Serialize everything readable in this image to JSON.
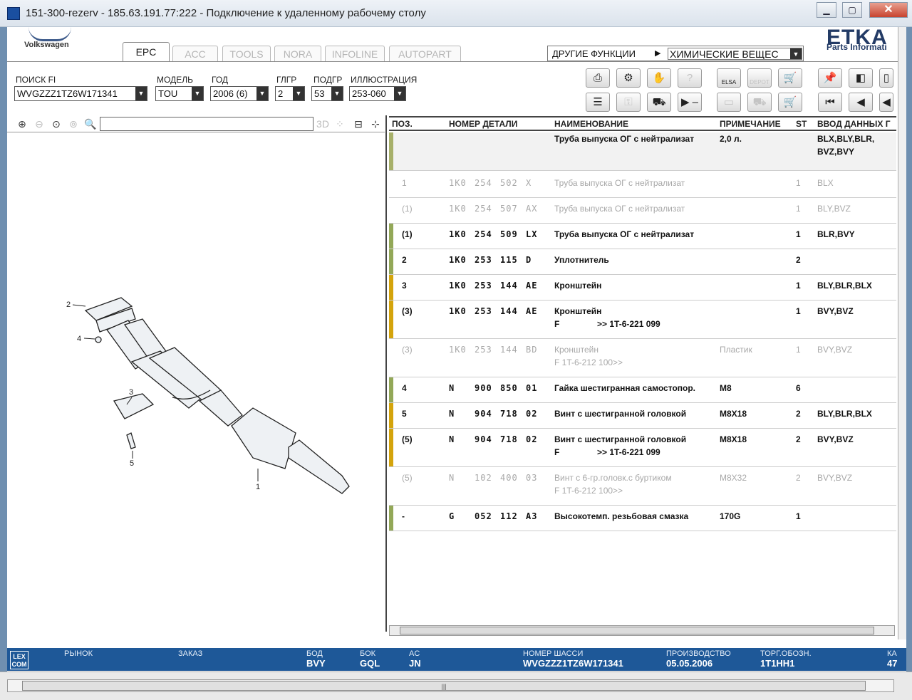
{
  "window": {
    "title": "151-300-rezerv - 185.63.191.77:222 - Подключение к удаленному рабочему столу"
  },
  "brand": {
    "vw": "Volkswagen",
    "etka": "ETKA",
    "etka_sub": "Parts Informati"
  },
  "tabs": [
    "EPC",
    "ACC",
    "TOOLS",
    "NORA",
    "INFOLINE",
    "AUTOPART"
  ],
  "other_functions": {
    "label": "ДРУГИЕ ФУНКЦИИ",
    "selected": "ХИМИЧЕСКИЕ ВЕЩЕС"
  },
  "filters": {
    "search_label": "ПОИСК FI",
    "search_value": "WVGZZZ1TZ6W171341",
    "model_label": "МОДЕЛЬ",
    "model_value": "TOU",
    "year_label": "ГОД",
    "year_value": "2006 (6)",
    "group_label": "ГЛГР",
    "group_value": "2",
    "subgroup_label": "ПОДГР",
    "subgroup_value": "53",
    "illustration_label": "ИЛЛЮСТРАЦИЯ",
    "illustration_value": "253-060"
  },
  "toolbar_icons": {
    "elsa": "ELSA",
    "depot": "DEPOT"
  },
  "illustration_labels": [
    "2",
    "4",
    "3",
    "5",
    "1"
  ],
  "grid": {
    "headers": {
      "pos": "ПОЗ.",
      "part": "НОМЕР ДЕТАЛИ",
      "name": "НАИМЕНОВАНИЕ",
      "note": "ПРИМЕЧАНИЕ",
      "st": "ST",
      "input": "ВВОД ДАННЫХ Г"
    },
    "header_row": {
      "name": "Труба выпуска ОГ с нейтрализат",
      "note": "2,0 л.",
      "input1": "BLX,BLY,BLR,",
      "input2": "BVZ,BVY"
    },
    "rows": [
      {
        "pos": "1",
        "p1": "1K0",
        "p2": "254",
        "p3": "502",
        "p4": "X",
        "name": "Труба выпуска ОГ с нейтрализат",
        "name2": "",
        "note": "",
        "st": "1",
        "input": "BLX"
      },
      {
        "pos": "(1)",
        "p1": "1K0",
        "p2": "254",
        "p3": "507",
        "p4": "AX",
        "name": "Труба выпуска ОГ с нейтрализат",
        "name2": "",
        "note": "",
        "st": "1",
        "input": "BLY,BVZ"
      },
      {
        "pos": "(1)",
        "p1": "1K0",
        "p2": "254",
        "p3": "509",
        "p4": "LX",
        "name": "Труба выпуска ОГ с нейтрализат",
        "name2": "",
        "note": "",
        "st": "1",
        "input": "BLR,BVY"
      },
      {
        "pos": "2",
        "p1": "1K0",
        "p2": "253",
        "p3": "115",
        "p4": "D",
        "name": "Уплотнитель",
        "name2": "",
        "note": "",
        "st": "2",
        "input": ""
      },
      {
        "pos": "3",
        "p1": "1K0",
        "p2": "253",
        "p3": "144",
        "p4": "AE",
        "name": "Кронштейн",
        "name2": "",
        "note": "",
        "st": "1",
        "input": "BLY,BLR,BLX"
      },
      {
        "pos": "(3)",
        "p1": "1K0",
        "p2": "253",
        "p3": "144",
        "p4": "AE",
        "name": "Кронштейн",
        "name2a": "F",
        "name2b": ">> 1T-6-221 099",
        "note": "",
        "st": "1",
        "input": "BVY,BVZ"
      },
      {
        "pos": "(3)",
        "p1": "1K0",
        "p2": "253",
        "p3": "144",
        "p4": "BD",
        "name": "Кронштейн",
        "name2": "F 1T-6-212 100>>",
        "note": "Пластик",
        "st": "1",
        "input": "BVY,BVZ"
      },
      {
        "pos": "4",
        "p1": "N",
        "p2": "900",
        "p3": "850",
        "p4": "01",
        "name": "Гайка шестигранная самостопор.",
        "name2": "",
        "note": "M8",
        "st": "6",
        "input": ""
      },
      {
        "pos": "5",
        "p1": "N",
        "p2": "904",
        "p3": "718",
        "p4": "02",
        "name": "Винт с шестигранной головкой",
        "name2": "",
        "note": "M8X18",
        "st": "2",
        "input": "BLY,BLR,BLX"
      },
      {
        "pos": "(5)",
        "p1": "N",
        "p2": "904",
        "p3": "718",
        "p4": "02",
        "name": "Винт с шестигранной головкой",
        "name2a": "F",
        "name2b": ">> 1T-6-221 099",
        "note": "M8X18",
        "st": "2",
        "input": "BVY,BVZ"
      },
      {
        "pos": "(5)",
        "p1": "N",
        "p2": "102",
        "p3": "400",
        "p4": "03",
        "name": "Винт с 6-гр.головк.с буртиком",
        "name2": "F 1T-6-212 100>>",
        "note": "M8X32",
        "st": "2",
        "input": "BVY,BVZ"
      },
      {
        "pos": "-",
        "p1": "G",
        "p2": "052",
        "p3": "112",
        "p4": "A3",
        "name": "Высокотемп. резьбовая смазка",
        "name2": "",
        "note": "170G",
        "st": "1",
        "input": ""
      }
    ]
  },
  "status": {
    "lexcom": "LEX COM",
    "market_label": "РЫНОК",
    "order_label": "ЗАКАЗ",
    "bod_label": "БОД",
    "bod_value": "BVY",
    "bok_label": "БОК",
    "bok_value": "GQL",
    "ac_label": "AC",
    "ac_value": "JN",
    "chassis_label": "НОМЕР ШАССИ",
    "chassis_value": "WVGZZZ1TZ6W171341",
    "prod_label": "ПРОИЗВОДСТВО",
    "prod_value": "05.05.2006",
    "trade_label": "ТОРГ.ОБОЗН.",
    "trade_value": "1T1HH1",
    "ka_label": "КА",
    "ka_value": "47"
  },
  "colors": {
    "green": "#93a858",
    "yellow": "#d4a40c",
    "gray_mark": "#a7b06a",
    "status_bg": "#1e5898"
  }
}
